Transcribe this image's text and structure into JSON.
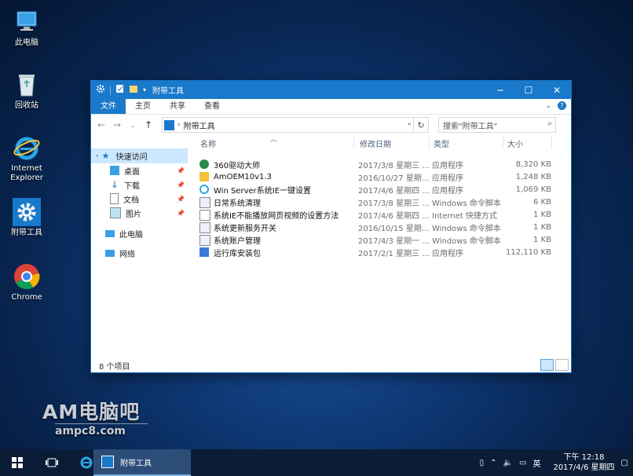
{
  "desktop": {
    "icons": [
      {
        "label": "此电脑"
      },
      {
        "label": "回收站"
      },
      {
        "label": "Internet\nExplorer"
      },
      {
        "label": "附带工具"
      },
      {
        "label": "Chrome"
      }
    ]
  },
  "window": {
    "title": "附带工具",
    "ribbon_tabs": [
      "文件",
      "主页",
      "共享",
      "查看"
    ],
    "address": "附带工具",
    "search_placeholder": "搜索\"附带工具\"",
    "nav": {
      "quick_access": "快速访问",
      "items": [
        "桌面",
        "下载",
        "文档",
        "图片"
      ],
      "this_pc": "此电脑",
      "network": "网络"
    },
    "columns": {
      "name": "名称",
      "date": "修改日期",
      "type": "类型",
      "size": "大小"
    },
    "files": [
      {
        "name": "360驱动大师",
        "date": "2017/3/8 星期三 ...",
        "type": "应用程序",
        "size": "8,320 KB"
      },
      {
        "name": "AmOEM10v1.3",
        "date": "2016/10/27 星期...",
        "type": "应用程序",
        "size": "1,248 KB"
      },
      {
        "name": "Win Server系统IE一键设置",
        "date": "2017/4/6 星期四 ...",
        "type": "应用程序",
        "size": "1,069 KB"
      },
      {
        "name": "日常系统清理",
        "date": "2017/3/8 星期三 ...",
        "type": "Windows 命令脚本",
        "size": "6 KB"
      },
      {
        "name": "系统IE不能播放网页视频的设置方法",
        "date": "2017/4/6 星期四 ...",
        "type": "Internet 快捷方式",
        "size": "1 KB"
      },
      {
        "name": "系统更新服务开关",
        "date": "2016/10/15 星期...",
        "type": "Windows 命令脚本",
        "size": "1 KB"
      },
      {
        "name": "系统账户管理",
        "date": "2017/4/3 星期一 ...",
        "type": "Windows 命令脚本",
        "size": "1 KB"
      },
      {
        "name": "运行库安装包",
        "date": "2017/2/1 星期三 ...",
        "type": "应用程序",
        "size": "112,110 KB"
      }
    ],
    "status": "8 个项目"
  },
  "watermark": {
    "line1": "AM电脑吧",
    "line2": "ampc8.com"
  },
  "taskbar": {
    "app_label": "附带工具",
    "ime": "英",
    "time": "下午 12:18",
    "date": "2017/4/6 星期四"
  },
  "colors": {
    "accent": "#1979ca",
    "selection": "#cce8ff",
    "taskbar": "#0b1c36"
  }
}
